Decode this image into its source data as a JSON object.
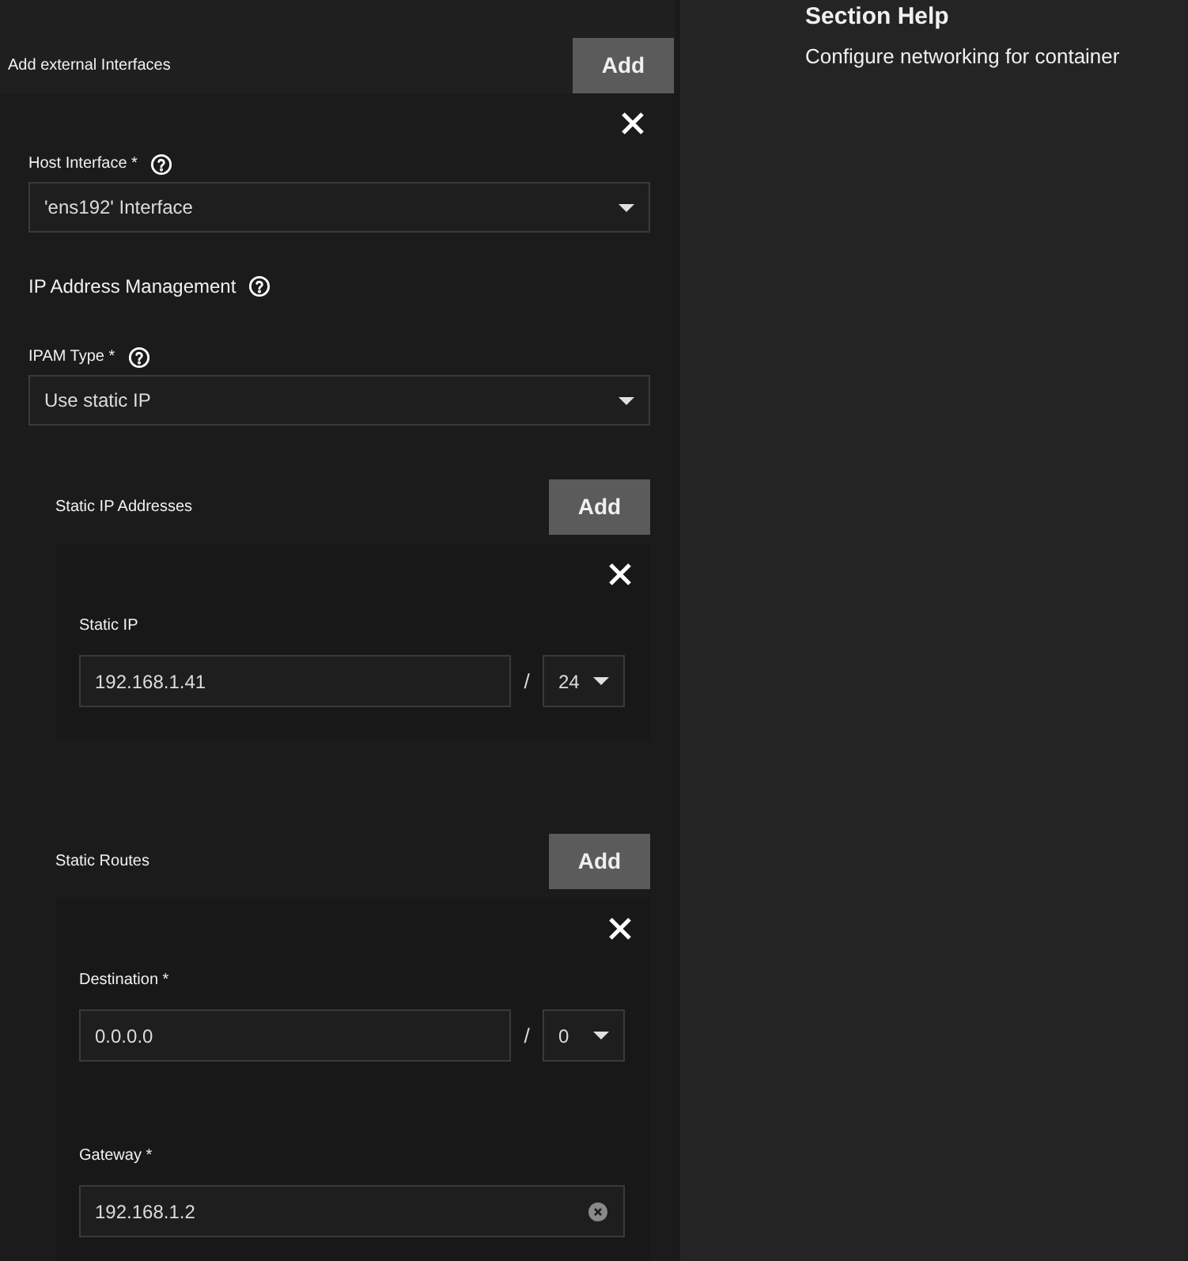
{
  "section": {
    "title": "Add external Interfaces",
    "add_button": "Add",
    "items": [
      {
        "host_interface": {
          "label": "Host Interface *",
          "value": "'ens192' Interface"
        },
        "ipam_heading": "IP Address Management",
        "ipam_type": {
          "label": "IPAM Type *",
          "value": "Use static IP"
        },
        "static_ips": {
          "title": "Static IP Addresses",
          "add_button": "Add",
          "items": [
            {
              "label": "Static IP",
              "address": "192.168.1.41",
              "separator": "/",
              "prefix": "24"
            }
          ]
        },
        "static_routes": {
          "title": "Static Routes",
          "add_button": "Add",
          "items": [
            {
              "destination": {
                "label": "Destination *",
                "address": "0.0.0.0",
                "separator": "/",
                "prefix": "0"
              },
              "gateway": {
                "label": "Gateway *",
                "value": "192.168.1.2"
              }
            }
          ]
        }
      }
    ]
  },
  "help": {
    "title": "Section Help",
    "text": "Configure networking for container"
  }
}
